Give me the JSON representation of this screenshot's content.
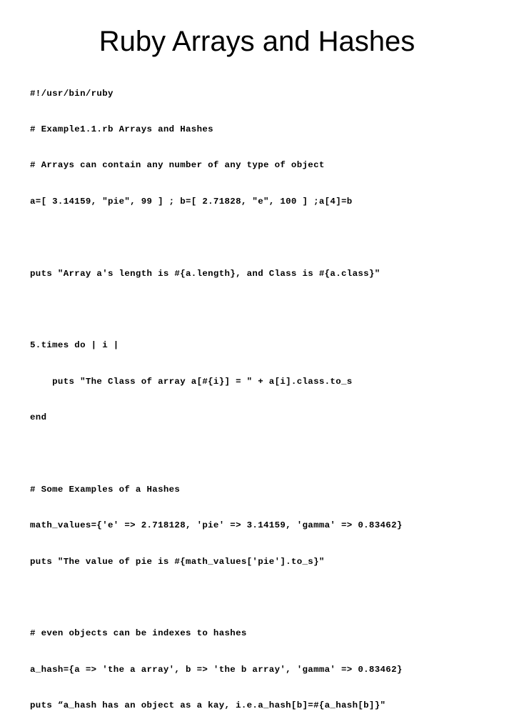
{
  "slide": {
    "title": "Ruby Arrays and Hashes",
    "code_lines": [
      "#!/usr/bin/ruby",
      "# Example1.1.rb Arrays and Hashes",
      "# Arrays can contain any number of any type of object",
      "a=[ 3.14159, \"pie\", 99 ] ; b=[ 2.71828, \"e\", 100 ] ;a[4]=b",
      "",
      "puts \"Array a's length is #{a.length}, and Class is #{a.class}\"",
      "",
      "5.times do | i |",
      "    puts \"The Class of array a[#{i}] = \" + a[i].class.to_s",
      "end",
      "",
      "# Some Examples of a Hashes",
      "math_values={'e' => 2.718128, 'pie' => 3.14159, 'gamma' => 0.83462}",
      "puts \"The value of pie is #{math_values['pie'].to_s}\"",
      "",
      "# even objects can be indexes to hashes",
      "a_hash={a => 'the a array', b => 'the b array', 'gamma' => 0.83462}",
      "puts “a_hash has an object as a kay, i.e.a_hash[b]=#{a_hash[b]}\""
    ]
  }
}
